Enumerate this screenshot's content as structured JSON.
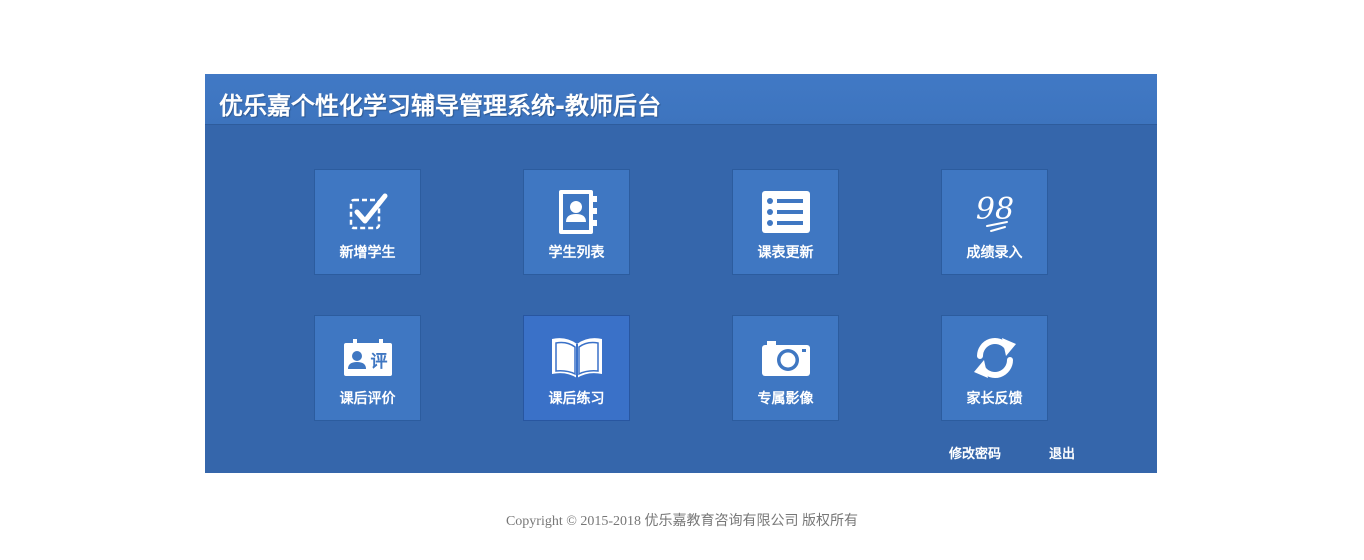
{
  "header": {
    "title": "优乐嘉个性化学习辅导管理系统-教师后台"
  },
  "tiles": [
    {
      "label": "新增学生",
      "icon": "checkbox-icon"
    },
    {
      "label": "学生列表",
      "icon": "contacts-book-icon"
    },
    {
      "label": "课表更新",
      "icon": "list-icon"
    },
    {
      "label": "成绩录入",
      "icon": "score-98-icon",
      "icon_text": "98"
    },
    {
      "label": "课后评价",
      "icon": "evaluation-card-icon",
      "icon_text": "评"
    },
    {
      "label": "课后练习",
      "icon": "open-book-icon"
    },
    {
      "label": "专属影像",
      "icon": "camera-icon"
    },
    {
      "label": "家长反馈",
      "icon": "refresh-icon"
    }
  ],
  "actions": {
    "change_password": "修改密码",
    "logout": "退出"
  },
  "footer": {
    "copyright": "Copyright © 2015-2018 优乐嘉教育咨询有限公司 版权所有"
  },
  "colors": {
    "panel_bg": "#3566ab",
    "header_bg": "#3d74be",
    "tile_bg": "#3f77c2",
    "text": "#ffffff",
    "copyright_text": "#777777"
  }
}
